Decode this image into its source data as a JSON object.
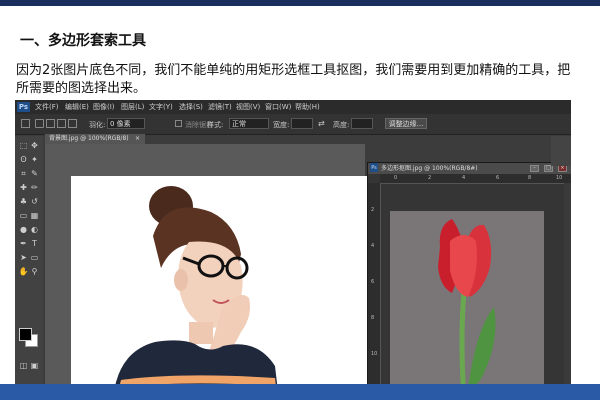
{
  "slide": {
    "heading": "一、多边形套索工具",
    "paragraph": "因为2张图片底色不同，我们不能单纯的用矩形选框工具抠图，我们需要用到更加精确的工具，把所需要的图选择出来。"
  },
  "photoshop": {
    "logo": "Ps",
    "menu": [
      "文件(F)",
      "编辑(E)",
      "图像(I)",
      "图层(L)",
      "文字(Y)",
      "选择(S)",
      "滤镜(T)",
      "视图(V)",
      "窗口(W)",
      "帮助(H)"
    ],
    "options": {
      "feather_label": "羽化:",
      "feather_value": "0 像素",
      "antialias_label": "消除锯齿",
      "style_label": "样式:",
      "style_value": "正常",
      "width_label": "宽度:",
      "height_label": "高度:",
      "refine_edge": "调整边缘..."
    },
    "doc_tab_1": "背景图.jpg @ 100%(RGB/8)",
    "doc_tab_close": "×",
    "doc_window_2": {
      "title": "多边形抠图.jpg @ 100%(RGB/8#)",
      "ruler_h": [
        "0",
        "2",
        "4",
        "6",
        "8",
        "10"
      ],
      "ruler_v": [
        "2",
        "4",
        "6",
        "8",
        "10"
      ]
    }
  },
  "colors": {
    "top_bar": "#1b2f5e",
    "bottom_bar": "#2a5aa6",
    "ps_background": "#3c3c3c",
    "tulip_background": "#7a7678"
  }
}
